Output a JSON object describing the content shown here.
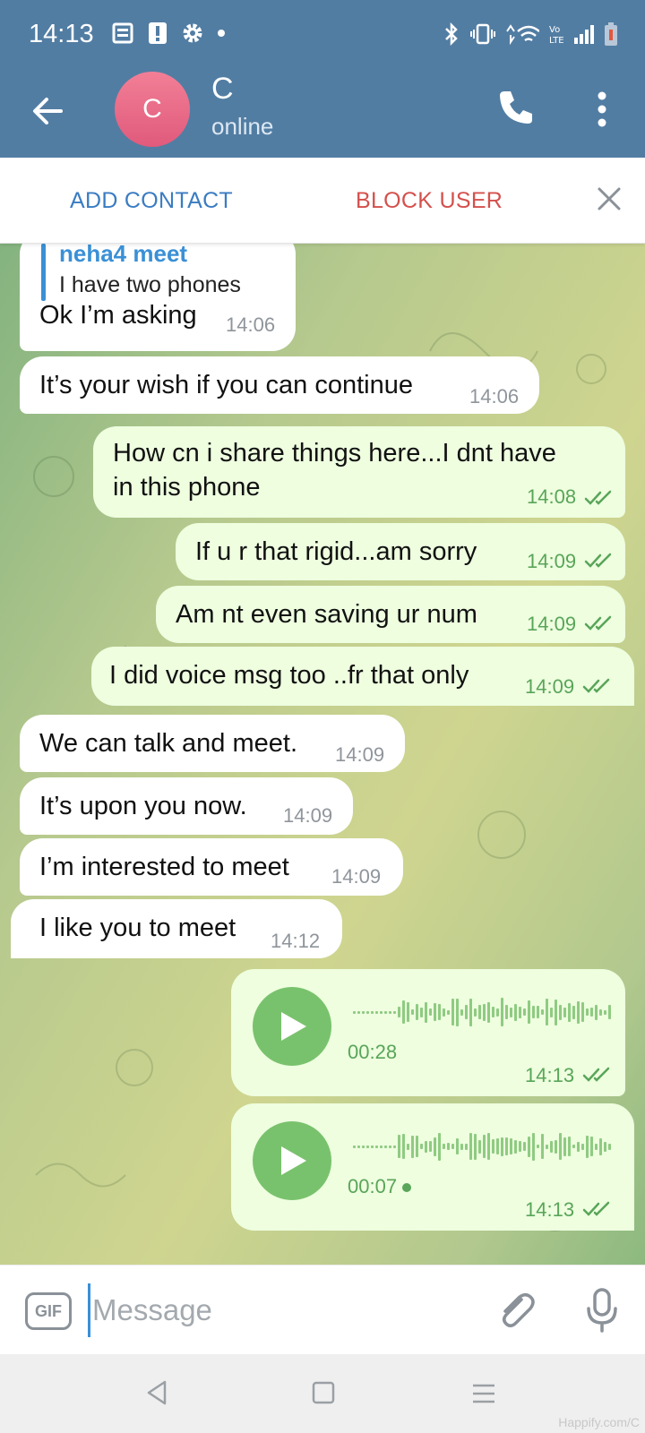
{
  "status_bar": {
    "time": "14:13"
  },
  "header": {
    "avatar_letter": "C",
    "name": "C",
    "status": "online"
  },
  "action_bar": {
    "add_contact": "ADD CONTACT",
    "block_user": "BLOCK USER"
  },
  "messages": [
    {
      "dir": "in",
      "reply_name": "neha4 meet",
      "reply_text": "I have two phones",
      "text": "Ok I’m asking",
      "time": "14:06"
    },
    {
      "dir": "in",
      "text": "It’s your wish if you can continue",
      "time": "14:06"
    },
    {
      "dir": "out",
      "text_line1": "How cn i share things here...I dnt have",
      "text_line2": "in this phone",
      "time": "14:08"
    },
    {
      "dir": "out",
      "text": "If u r that rigid...am sorry",
      "time": "14:09"
    },
    {
      "dir": "out",
      "text": "Am nt even saving ur num",
      "time": "14:09"
    },
    {
      "dir": "out",
      "text": "I did voice msg too ..fr that only",
      "time": "14:09"
    },
    {
      "dir": "in",
      "text": "We can talk and meet.",
      "time": "14:09"
    },
    {
      "dir": "in",
      "text": "It’s upon you now.",
      "time": "14:09"
    },
    {
      "dir": "in",
      "text": "I’m interested to meet",
      "time": "14:09"
    },
    {
      "dir": "in",
      "text": "I like you to meet",
      "time": "14:12"
    },
    {
      "dir": "out",
      "type": "voice",
      "duration": "00:28",
      "time": "14:13"
    },
    {
      "dir": "out",
      "type": "voice",
      "duration": "00:07",
      "time": "14:13",
      "unplayed": true
    }
  ],
  "input": {
    "placeholder": "Message",
    "value": "",
    "gif_label": "GIF"
  },
  "watermark": "Happify.com/C",
  "colors": {
    "header": "#527da3",
    "outgoing": "#eefedf",
    "incoming": "#ffffff",
    "accent_green": "#79c26d",
    "block_red": "#d4504c",
    "add_blue": "#3a7cc2"
  }
}
